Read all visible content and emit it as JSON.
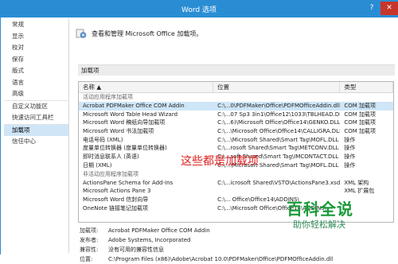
{
  "window": {
    "title": "Word 选项",
    "help_icon": "?",
    "close_icon": "✕"
  },
  "nav": {
    "items": [
      {
        "label": "常规",
        "active": false,
        "sep": false
      },
      {
        "label": "显示",
        "active": false,
        "sep": false
      },
      {
        "label": "校对",
        "active": false,
        "sep": false
      },
      {
        "label": "保存",
        "active": false,
        "sep": false
      },
      {
        "label": "版式",
        "active": false,
        "sep": false
      },
      {
        "label": "语言",
        "active": false,
        "sep": false
      },
      {
        "label": "高级",
        "active": false,
        "sep": false
      },
      {
        "label": "自定义功能区",
        "active": false,
        "sep": true
      },
      {
        "label": "快速访问工具栏",
        "active": false,
        "sep": false
      },
      {
        "label": "加载项",
        "active": true,
        "sep": true
      },
      {
        "label": "信任中心",
        "active": false,
        "sep": false
      }
    ]
  },
  "content": {
    "header_text": "查看和管理 Microsoft Office 加载项。",
    "section_label": "加载项",
    "columns": {
      "name": "名称 ▲",
      "location": "位置",
      "type": "类型"
    },
    "groups": [
      {
        "label": "活动应用程序加载项",
        "rows": [
          {
            "name": "Acrobat PDFMaker Office COM Addin",
            "location": "C:\\...0\\PDFMaker\\Office\\PDFMOfficeAddin.dll",
            "type": "COM 加载项",
            "selected": true
          },
          {
            "name": "Microsoft Word Table Head Wizard",
            "location": "C:\\...07 Sp3 3in1\\Office12\\1033\\TBLHEAD.DLL",
            "type": "COM 加载项",
            "selected": false
          },
          {
            "name": "Microsoft Word 稿纸向导加载项",
            "location": "C:\\...6)\\Microsoft Office\\Office14\\GENKO.DLL",
            "type": "COM 加载项",
            "selected": false
          },
          {
            "name": "Microsoft Word 书法加载项",
            "location": "C:\\...\\Microsoft Office\\Office14\\CALLIGRA.DLL",
            "type": "COM 加载项",
            "selected": false
          },
          {
            "name": "电话号码 (XML)",
            "location": "C:\\...\\Microsoft Shared\\Smart Tag\\MOFL.DLL",
            "type": "操作",
            "selected": false
          },
          {
            "name": "度量单位转换器 (度量单位转换器)",
            "location": "C:\\...rosoft Shared\\Smart Tag\\METCONV.DLL",
            "type": "操作",
            "selected": false
          },
          {
            "name": "即时消息联系人 (英语)",
            "location": "C:\\...soft Shared\\Smart Tag\\IMCONTACT.DLL",
            "type": "操作",
            "selected": false
          },
          {
            "name": "日期 (XML)",
            "location": "C:\\...\\Microsoft Shared\\Smart Tag\\MOFL.DLL",
            "type": "操作",
            "selected": false
          }
        ]
      },
      {
        "label": "非活动应用程序加载项",
        "rows": [
          {
            "name": "ActionsPane Schema for Add-Ins",
            "location": "C:\\...icrosoft Shared\\VSTO\\ActionsPane3.xsd",
            "type": "XML 架构",
            "selected": false
          },
          {
            "name": "Microsoft Actions Pane 3",
            "location": "",
            "type": "XML 扩展包",
            "selected": false
          },
          {
            "name": "Microsoft Word 信封向导",
            "location": "C:\\... Office\\Office14\\ADDINS\\",
            "type": "",
            "selected": false
          },
          {
            "name": "OneNote 链接笔记加载项",
            "location": "C:\\...\\Microsoft Office\\Office14\\ADDINS\\",
            "type": "",
            "selected": false
          }
        ]
      }
    ],
    "details": [
      {
        "label": "加载项:",
        "value": "Acrobat PDFMaker Office COM Addin"
      },
      {
        "label": "发布者:",
        "value": "Adobe Systems, Incorporated"
      },
      {
        "label": "兼容性:",
        "value": "没有可用的兼容性信息"
      },
      {
        "label": "位置:",
        "value": "C:\\Program Files (x86)\\Adobe\\Acrobat 10.0\\PDFMaker\\Office\\PDFMOfficeAddin.dll"
      }
    ]
  },
  "overlay": {
    "annotation": "这些都是加载项"
  },
  "watermark": {
    "title": "百科全说",
    "subtitle": "助你轻松解决"
  }
}
